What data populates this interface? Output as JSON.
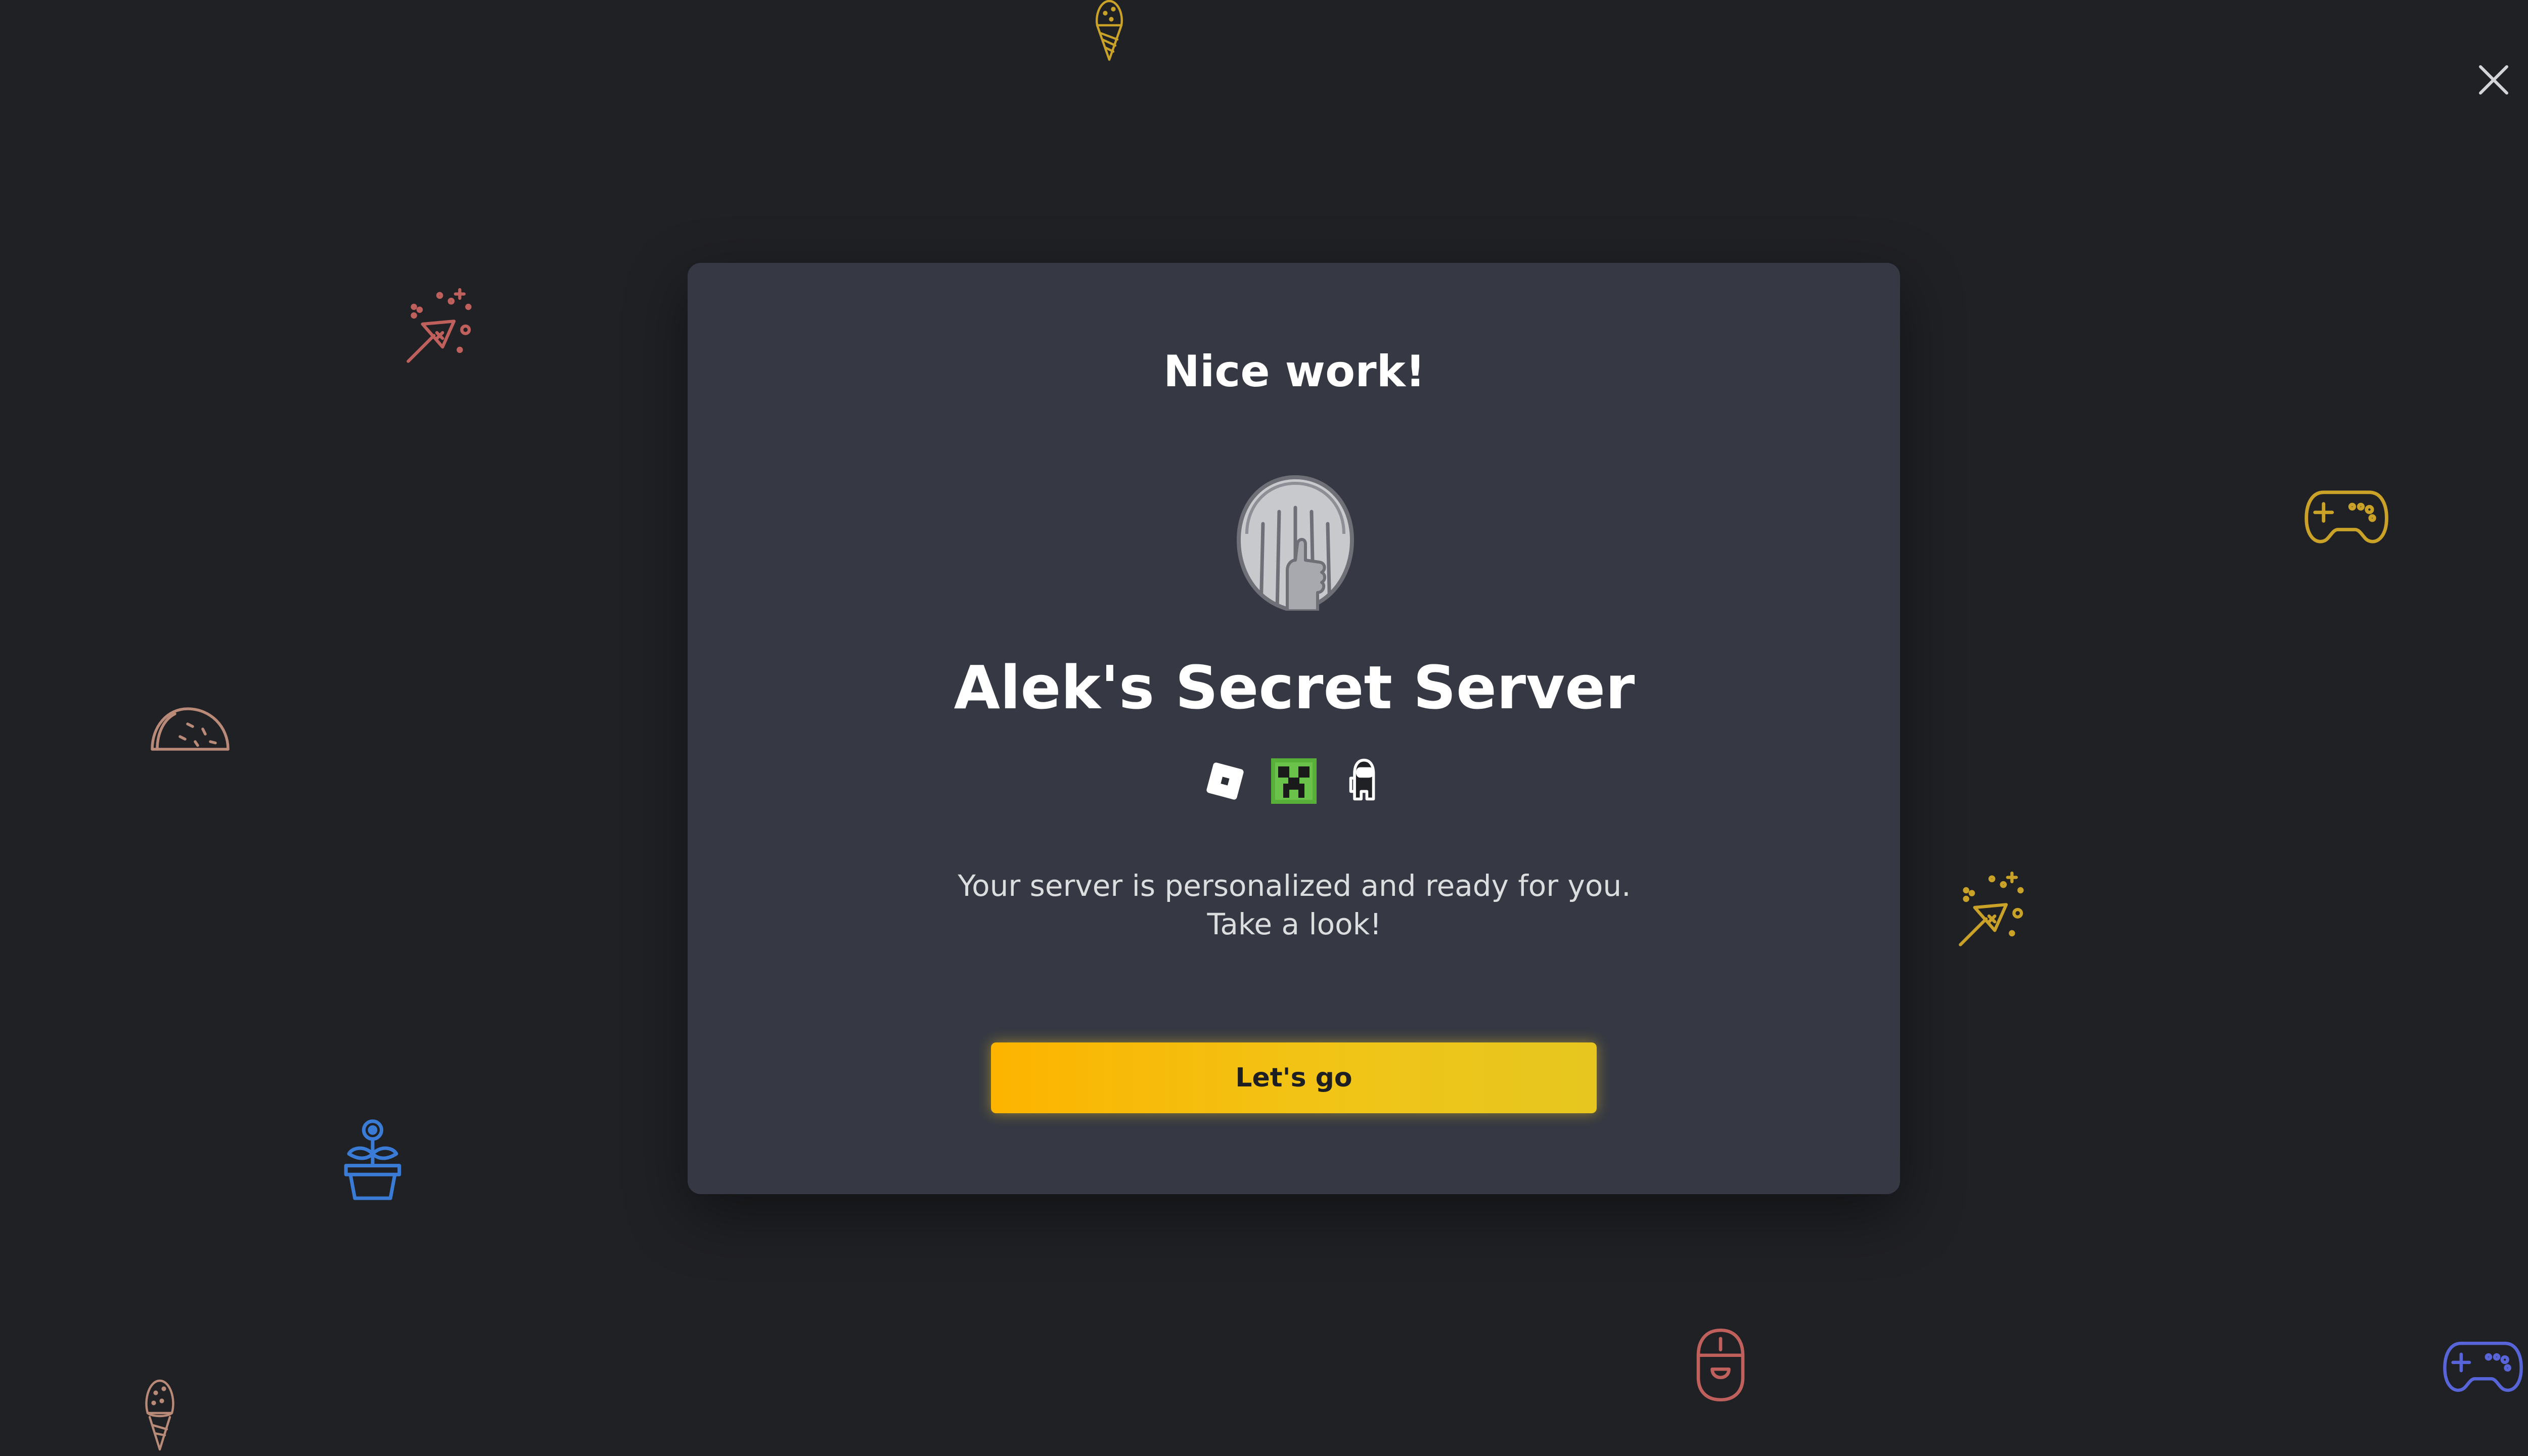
{
  "dialog": {
    "title": "Nice work!",
    "server_name": "Alek's Secret Server",
    "server_icon": "thumbs-up-shell-icon",
    "game_icons": [
      "roblox-icon",
      "minecraft-creeper-icon",
      "among-us-crewmate-icon"
    ],
    "description_line1": "Your server is personalized and ready for you.",
    "description_line2": "Take a look!",
    "cta_label": "Let's go",
    "close_icon": "close-icon"
  },
  "background_decorations": [
    "ice-cream-cone-icon",
    "party-popper-icon",
    "game-controller-icon",
    "taco-icon",
    "party-popper-icon",
    "potted-plant-icon",
    "ice-cream-cone-icon",
    "computer-mouse-icon",
    "game-controller-icon"
  ],
  "colors": {
    "background": "#202125",
    "modal": "#363943",
    "accent_yellow": "#fdb400",
    "coral": "#c0605c",
    "gold": "#c9a227",
    "blue": "#3a7bd5",
    "indigo": "#5865d8",
    "tan": "#b98a78"
  }
}
